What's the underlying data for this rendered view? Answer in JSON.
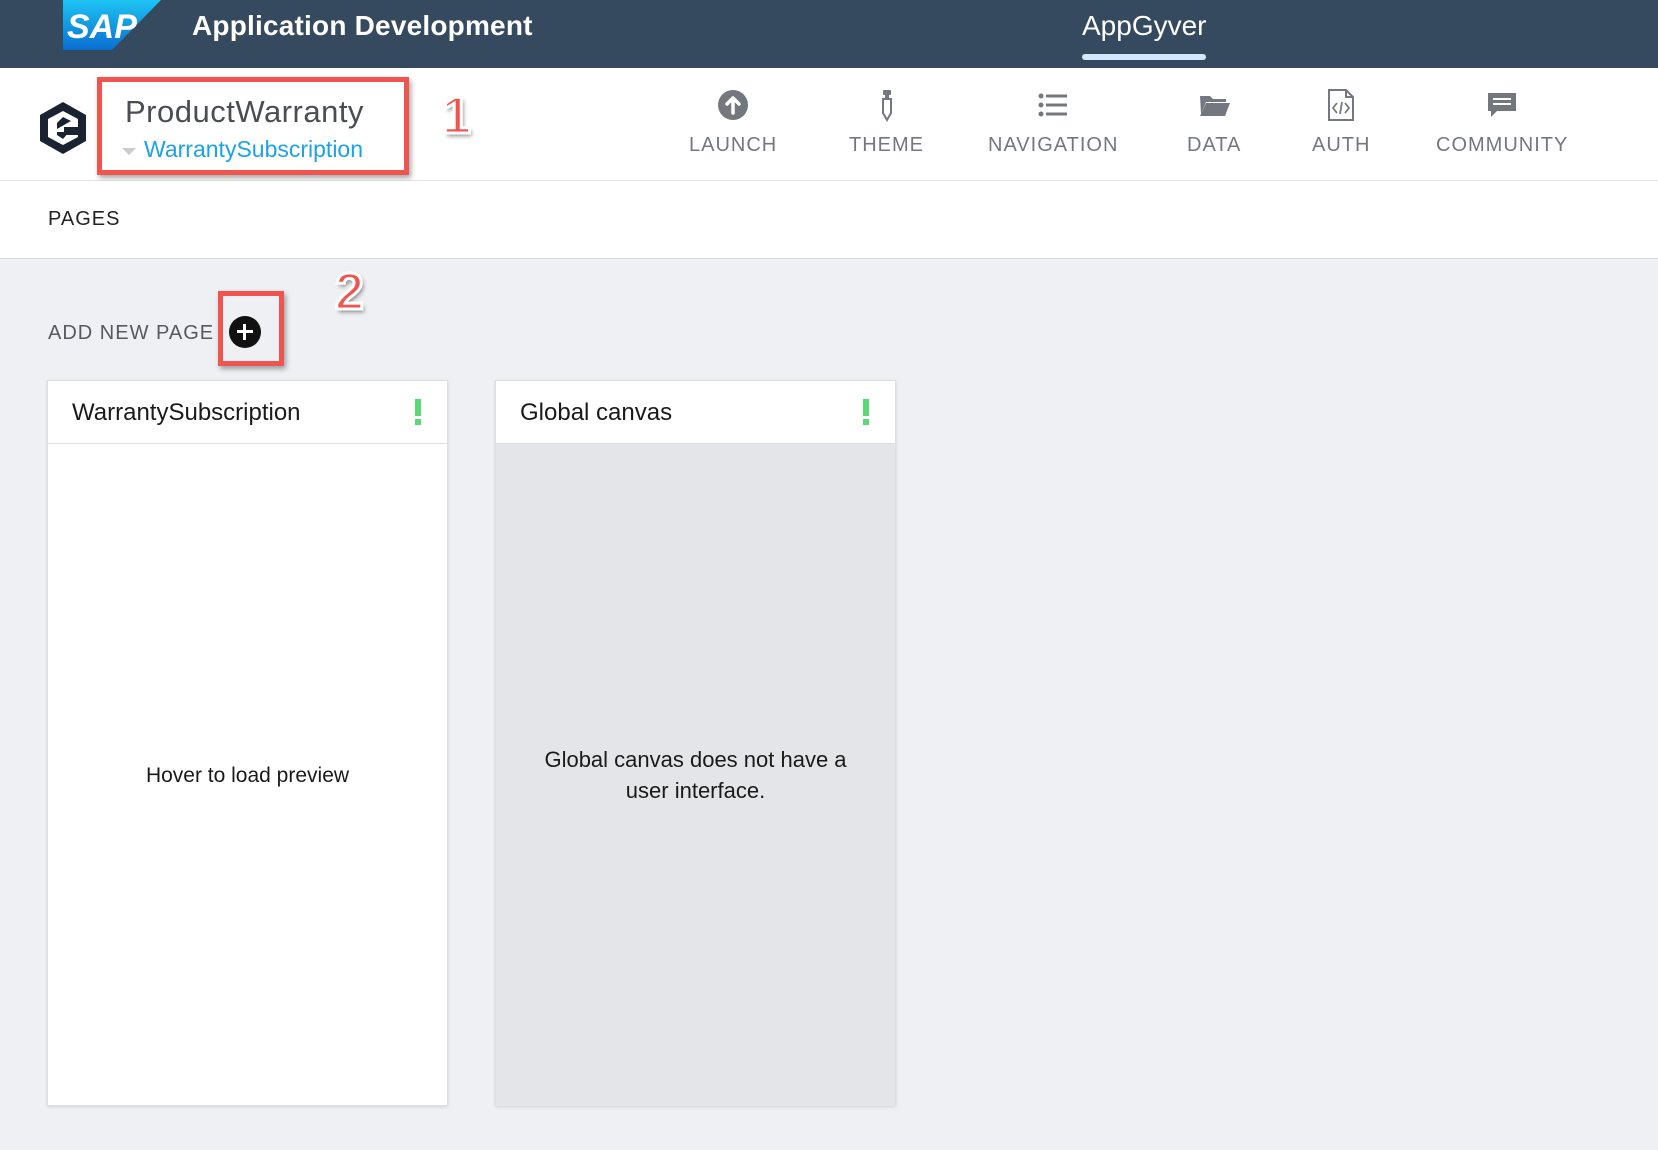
{
  "shell": {
    "logo_text": "SAP",
    "title": "Application Development",
    "tab": "AppGyver"
  },
  "app": {
    "project_name": "ProductWarranty",
    "current_page": "WarrantySubscription",
    "callout_1": "1",
    "callout_2": "2",
    "nav": [
      {
        "label": "LAUNCH",
        "icon": "upload-circle-icon"
      },
      {
        "label": "THEME",
        "icon": "pipette-icon"
      },
      {
        "label": "NAVIGATION",
        "icon": "list-icon"
      },
      {
        "label": "DATA",
        "icon": "folder-icon"
      },
      {
        "label": "AUTH",
        "icon": "code-file-icon"
      },
      {
        "label": "COMMUNITY",
        "icon": "chat-icon"
      }
    ]
  },
  "pages": {
    "title": "PAGES",
    "add_label": "ADD NEW PAGE",
    "cards": [
      {
        "title": "WarrantySubscription",
        "message": "Hover to load preview"
      },
      {
        "title": "Global canvas",
        "message": "Global canvas does not have a user interface."
      }
    ]
  },
  "colors": {
    "shellbar": "#354a5f",
    "link": "#1aa3e8",
    "highlight": "#f0544f",
    "status_ok": "#5dd879"
  }
}
